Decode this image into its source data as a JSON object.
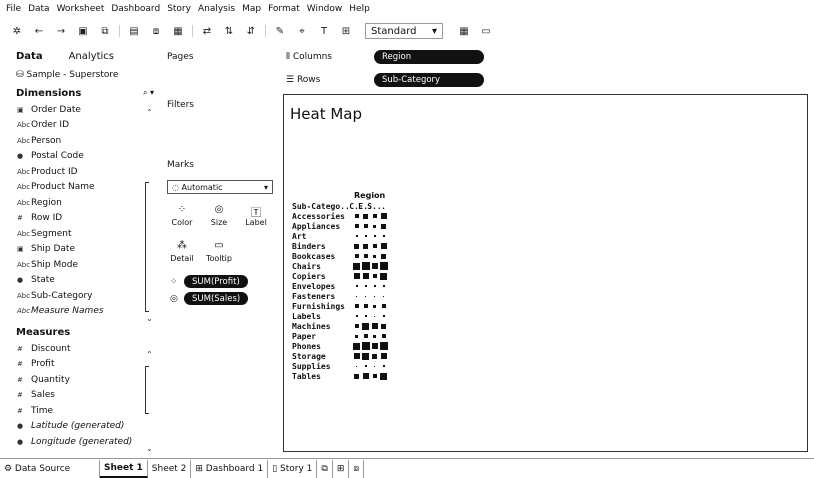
{
  "menu": [
    "File",
    "Data",
    "Worksheet",
    "Dashboard",
    "Story",
    "Analysis",
    "Map",
    "Format",
    "Window",
    "Help"
  ],
  "toolbar": {
    "fit": "Standard"
  },
  "datapane": {
    "tabs": [
      "Data",
      "Analytics"
    ],
    "source": "Sample - Superstore",
    "dimensions_title": "Dimensions",
    "dimensions": [
      {
        "icon": "date-icon",
        "label": "Order Date",
        "italic": false
      },
      {
        "icon": "abc-icon",
        "label": "Order ID",
        "italic": false
      },
      {
        "icon": "abc-icon",
        "label": "Person",
        "italic": false
      },
      {
        "icon": "globe-icon",
        "label": "Postal Code",
        "italic": false
      },
      {
        "icon": "abc-icon",
        "label": "Product ID",
        "italic": false
      },
      {
        "icon": "abc-icon",
        "label": "Product Name",
        "italic": false
      },
      {
        "icon": "abc-icon",
        "label": "Region",
        "italic": false
      },
      {
        "icon": "number-icon",
        "label": "Row ID",
        "italic": false
      },
      {
        "icon": "abc-icon",
        "label": "Segment",
        "italic": false
      },
      {
        "icon": "date-icon",
        "label": "Ship Date",
        "italic": false
      },
      {
        "icon": "abc-icon",
        "label": "Ship Mode",
        "italic": false
      },
      {
        "icon": "globe-icon",
        "label": "State",
        "italic": false
      },
      {
        "icon": "abc-icon",
        "label": "Sub-Category",
        "italic": false
      },
      {
        "icon": "abc-icon",
        "label": "Measure Names",
        "italic": true
      }
    ],
    "measures_title": "Measures",
    "measures": [
      {
        "icon": "number-icon",
        "label": "Discount",
        "italic": false
      },
      {
        "icon": "number-icon",
        "label": "Profit",
        "italic": false
      },
      {
        "icon": "number-icon",
        "label": "Quantity",
        "italic": false
      },
      {
        "icon": "number-icon",
        "label": "Sales",
        "italic": false
      },
      {
        "icon": "number-icon",
        "label": "Time",
        "italic": false
      },
      {
        "icon": "globe-icon",
        "label": "Latitude (generated)",
        "italic": true
      },
      {
        "icon": "globe-icon",
        "label": "Longitude (generated)",
        "italic": true
      }
    ]
  },
  "cards": {
    "pages": "Pages",
    "filters": "Filters",
    "marks": "Marks",
    "mark_type": "Automatic",
    "mark_buttons": [
      "Color",
      "Size",
      "Label",
      "Detail",
      "Tooltip"
    ],
    "pills": [
      "SUM(Profit)",
      "SUM(Sales)"
    ]
  },
  "shelves": {
    "columns_label": "Columns",
    "columns_pill": "Region",
    "rows_label": "Rows",
    "rows_pill": "Sub-Category"
  },
  "view": {
    "title": "Heat Map",
    "col_header": "Region",
    "row_header": "Sub-Catego..",
    "regions": [
      "C..",
      "E..",
      "S..",
      "."
    ]
  },
  "chart_data": {
    "type": "heatmap",
    "title": "Heat Map",
    "xlabel": "Region",
    "ylabel": "Sub-Category",
    "x": [
      "C..",
      "E..",
      "S..",
      "."
    ],
    "y": [
      "Accessories",
      "Appliances",
      "Art",
      "Binders",
      "Bookcases",
      "Chairs",
      "Copiers",
      "Envelopes",
      "Fasteners",
      "Furnishings",
      "Labels",
      "Machines",
      "Paper",
      "Phones",
      "Storage",
      "Supplies",
      "Tables"
    ],
    "size_measure": "SUM(Sales)",
    "color_measure": "SUM(Profit)",
    "relative_size": [
      [
        0.55,
        0.6,
        0.55,
        0.8
      ],
      [
        0.45,
        0.5,
        0.4,
        0.6
      ],
      [
        0.25,
        0.3,
        0.25,
        0.3
      ],
      [
        0.6,
        0.65,
        0.55,
        0.8
      ],
      [
        0.45,
        0.5,
        0.35,
        0.6
      ],
      [
        0.9,
        1.0,
        0.7,
        1.0
      ],
      [
        0.7,
        0.8,
        0.5,
        0.9
      ],
      [
        0.2,
        0.25,
        0.2,
        0.25
      ],
      [
        0.1,
        0.1,
        0.1,
        0.1
      ],
      [
        0.45,
        0.5,
        0.4,
        0.55
      ],
      [
        0.2,
        0.2,
        0.15,
        0.2
      ],
      [
        0.55,
        0.85,
        0.7,
        0.6
      ],
      [
        0.4,
        0.45,
        0.35,
        0.5
      ],
      [
        0.85,
        1.0,
        0.7,
        1.0
      ],
      [
        0.7,
        0.85,
        0.6,
        0.8
      ],
      [
        0.15,
        0.2,
        0.15,
        0.2
      ],
      [
        0.6,
        0.75,
        0.55,
        0.85
      ]
    ]
  }
}
